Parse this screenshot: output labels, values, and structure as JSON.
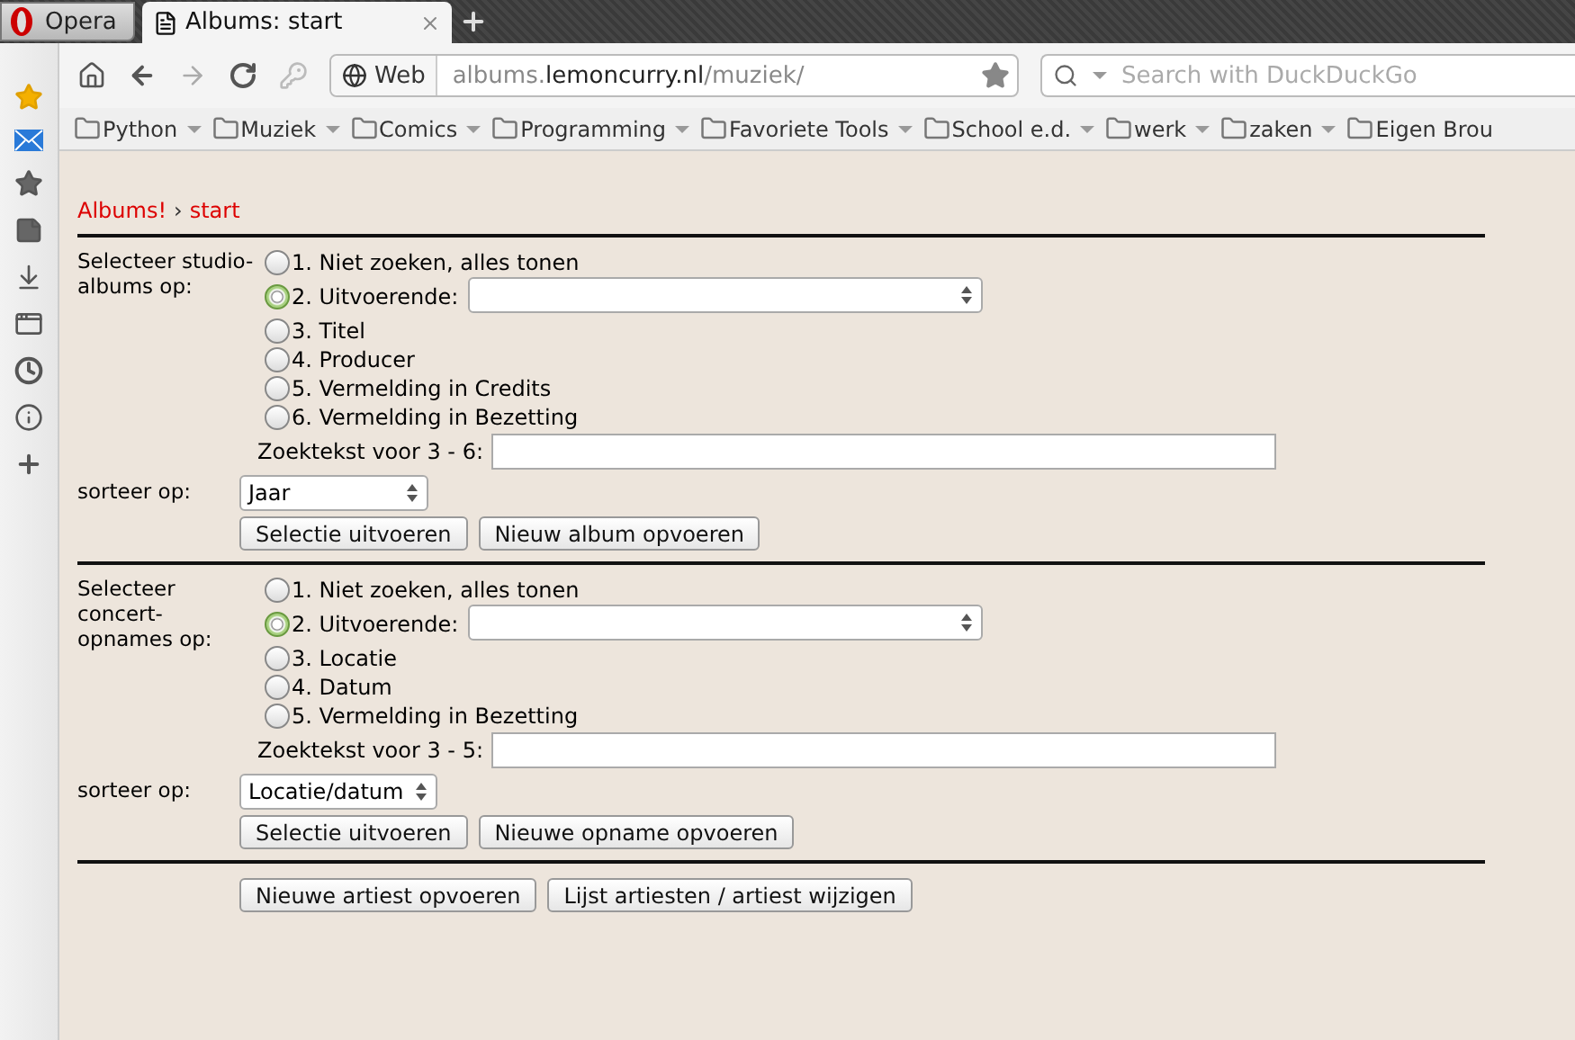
{
  "browser": {
    "menu_button": "Opera",
    "tabs": [
      {
        "title": "Albums: start",
        "selected": true
      }
    ],
    "address": {
      "scheme": "Web",
      "host_prefix": "albums.",
      "domain": "lemoncurry.nl",
      "path": "/muziek/"
    },
    "search": {
      "placeholder": "Search with DuckDuckGo"
    },
    "bookmarks": [
      "Python",
      "Muziek",
      "Comics",
      "Programming",
      "Favoriete Tools",
      "School e.d.",
      "werk",
      "zaken",
      "Eigen Brou"
    ]
  },
  "page": {
    "breadcrumb": {
      "home": "Albums!",
      "separator": "›",
      "current": "start"
    },
    "sections": [
      {
        "label": "Selecteer studio-\nalbums op:",
        "options": [
          {
            "label": "1. Niet zoeken, alles tonen",
            "selected": false,
            "kind": "radio"
          },
          {
            "label": "2. Uitvoerende:",
            "selected": true,
            "kind": "radio-select"
          },
          {
            "label": "3. Titel",
            "selected": false,
            "kind": "radio"
          },
          {
            "label": "4. Producer",
            "selected": false,
            "kind": "radio"
          },
          {
            "label": "5. Vermelding in Credits",
            "selected": false,
            "kind": "radio"
          },
          {
            "label": "6. Vermelding in Bezetting",
            "selected": false,
            "kind": "radio"
          }
        ],
        "search_label": "Zoektekst voor 3 - 6:",
        "sort_label": "sorteer op:",
        "sort_value": "Jaar",
        "buttons": [
          "Selectie uitvoeren",
          "Nieuw album opvoeren"
        ]
      },
      {
        "label": "Selecteer\nconcert-\nopnames op:",
        "options": [
          {
            "label": "1. Niet zoeken, alles tonen",
            "selected": false,
            "kind": "radio"
          },
          {
            "label": "2. Uitvoerende:",
            "selected": true,
            "kind": "radio-select"
          },
          {
            "label": "3. Locatie",
            "selected": false,
            "kind": "radio"
          },
          {
            "label": "4. Datum",
            "selected": false,
            "kind": "radio"
          },
          {
            "label": "5. Vermelding in Bezetting",
            "selected": false,
            "kind": "radio"
          }
        ],
        "search_label": "Zoektekst voor 3 - 5:",
        "sort_label": "sorteer op:",
        "sort_value": "Locatie/datum",
        "buttons": [
          "Selectie uitvoeren",
          "Nieuwe opname opvoeren"
        ]
      }
    ],
    "footer_buttons": [
      "Nieuwe artiest opvoeren",
      "Lijst artiesten / artiest wijzigen"
    ]
  }
}
